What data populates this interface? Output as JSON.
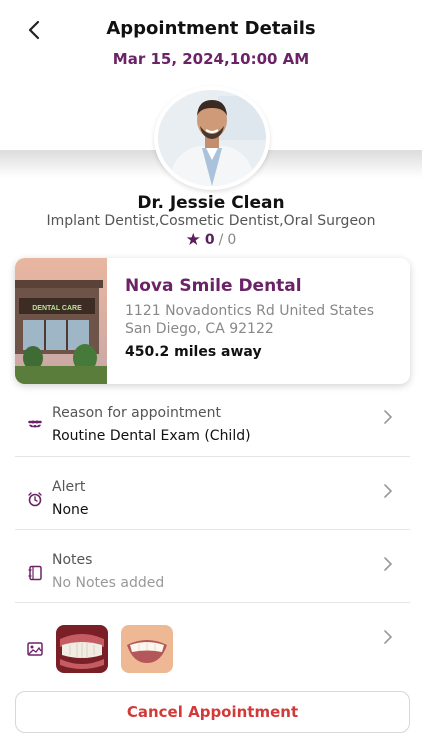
{
  "header": {
    "title": "Appointment Details",
    "datetime": "Mar 15, 2024,10:00 AM"
  },
  "doctor": {
    "name": "Dr. Jessie Clean",
    "specialties": "Implant Dentist,Cosmetic Dentist,Oral Surgeon",
    "rating": "0",
    "rating_sep": "/",
    "rating_total": "0"
  },
  "clinic": {
    "name": "Nova Smile Dental",
    "address_line1": "1121 Novadontics Rd United States",
    "address_line2": "San Diego, CA 92122",
    "distance": "450.2  miles away",
    "sign_text": "DENTAL CARE"
  },
  "details": {
    "reason_label": "Reason for appointment",
    "reason_value": "Routine Dental Exam (Child)",
    "alert_label": "Alert",
    "alert_value": "None",
    "notes_label": "Notes",
    "notes_value": "No Notes added"
  },
  "actions": {
    "cancel_label": "Cancel Appointment"
  },
  "colors": {
    "brand_purple": "#6b2367",
    "cancel_red": "#d23a3a"
  },
  "icons": {
    "back": "chevron-left-icon",
    "star": "star-icon",
    "reason": "teeth-icon",
    "alert": "alarm-clock-icon",
    "notes": "notebook-icon",
    "photos": "image-icon",
    "chevron": "chevron-right-icon"
  }
}
